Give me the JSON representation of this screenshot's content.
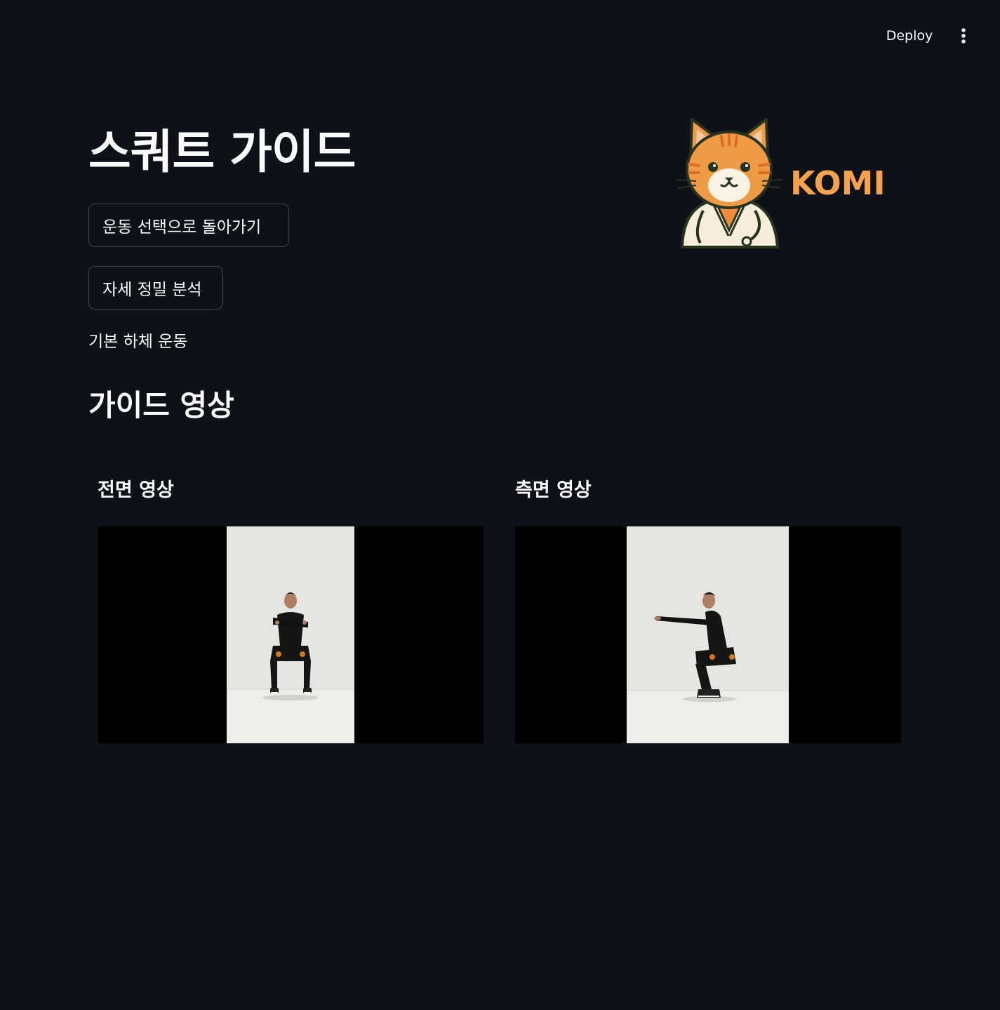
{
  "header": {
    "deploy_label": "Deploy",
    "menu_icon": "vertical-ellipsis-icon"
  },
  "page": {
    "title": "스쿼트 가이드",
    "back_button_label": "운동 선택으로 돌아가기",
    "analysis_button_label": "자세 정밀 분석",
    "caption": "기본 하체 운동",
    "section_title": "가이드 영상"
  },
  "logo": {
    "text": "KOMI",
    "icon": "cat-doctor-mascot",
    "text_color": "#f4a34a"
  },
  "videos": [
    {
      "title": "전면 영상",
      "view": "front"
    },
    {
      "title": "측면 영상",
      "view": "side"
    }
  ],
  "colors": {
    "background": "#0e1117",
    "text": "#fafafa",
    "button_border": "#3a3d44"
  }
}
